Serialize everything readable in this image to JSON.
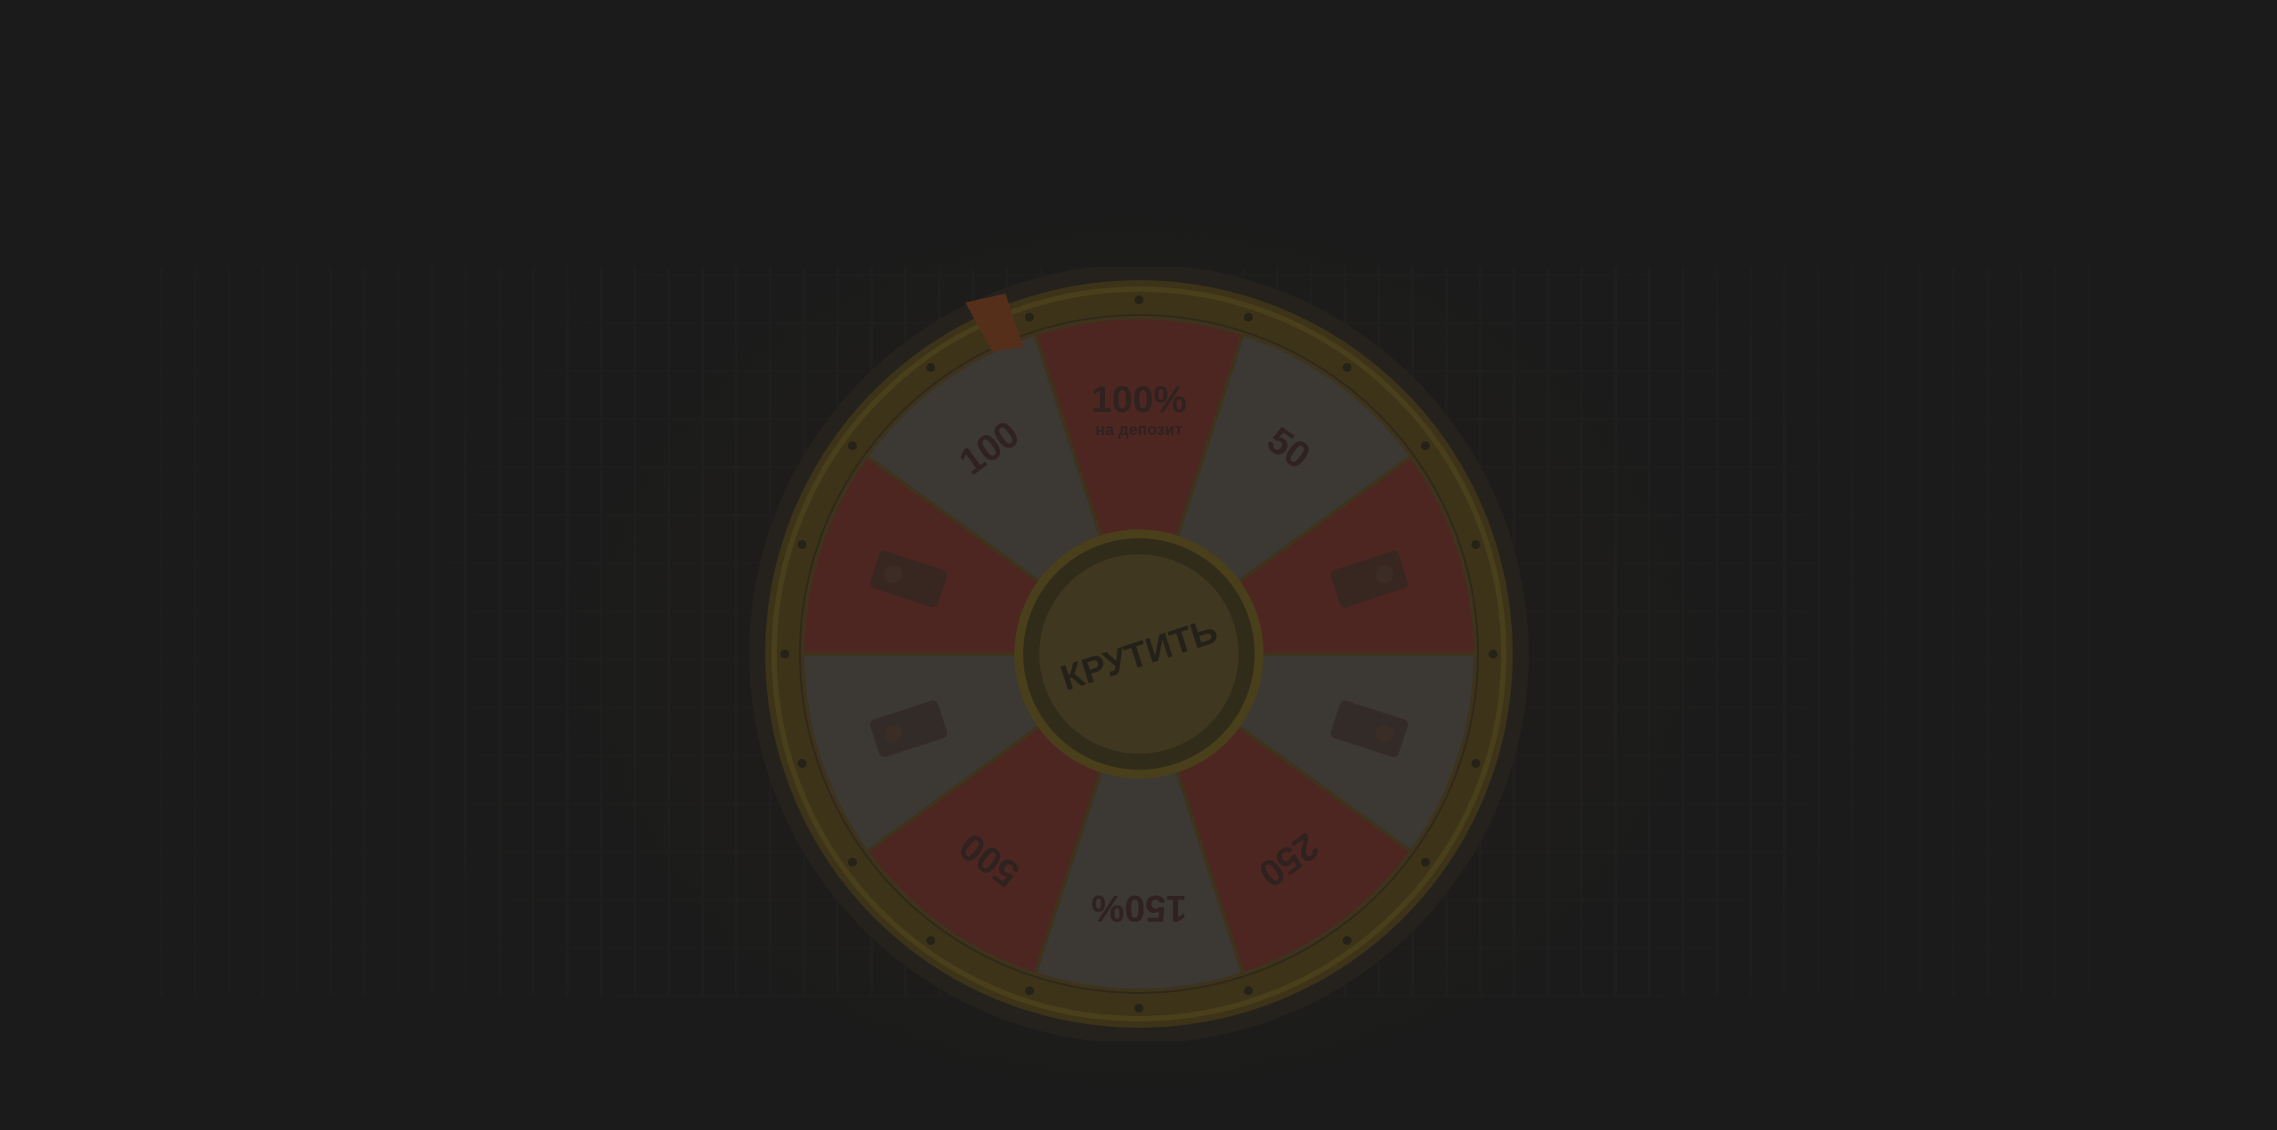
{
  "wheel": {
    "spin_button_label": "КРУТИТЬ",
    "sectors": [
      {
        "id": "pct100",
        "big": "100%",
        "small": "на депозит",
        "kind": "text",
        "color": "#5f2f2a"
      },
      {
        "id": "fs50",
        "big": "50",
        "small": "",
        "kind": "text",
        "color": "#4a4540"
      },
      {
        "id": "prize-right",
        "big": "",
        "small": "",
        "kind": "prize",
        "color": "#5f2f2a"
      },
      {
        "id": "prize-right-lower",
        "big": "",
        "small": "",
        "kind": "prize",
        "color": "#4a4540"
      },
      {
        "id": "fs250",
        "big": "250",
        "small": "",
        "kind": "text",
        "color": "#5f2f2a"
      },
      {
        "id": "pct150",
        "big": "150%",
        "small": "",
        "kind": "text",
        "color": "#4a4540"
      },
      {
        "id": "fs500",
        "big": "500",
        "small": "",
        "kind": "text",
        "color": "#5f2f2a"
      },
      {
        "id": "prize-left-lower",
        "big": "",
        "small": "",
        "kind": "prize",
        "color": "#4a4540"
      },
      {
        "id": "prize-left",
        "big": "",
        "small": "",
        "kind": "prize",
        "color": "#5f2f2a"
      },
      {
        "id": "fs100",
        "big": "100",
        "small": "",
        "kind": "text",
        "color": "#4a4540"
      }
    ],
    "colors": {
      "rim": "#4a3f1f",
      "rim_highlight": "#5b4d22",
      "hub": "#4e4426",
      "hub_text": "#2c2820",
      "sector_text": "#3a2a27",
      "pointer": "#6a3a22"
    }
  }
}
